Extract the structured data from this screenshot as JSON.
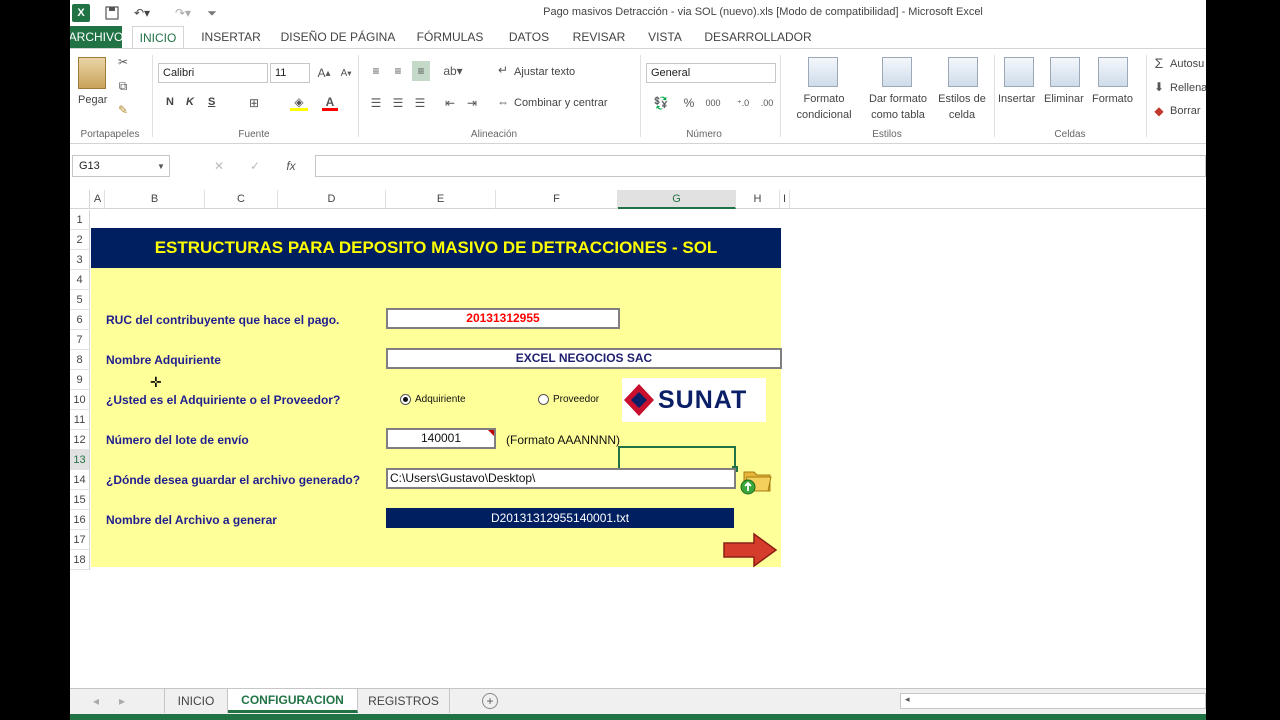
{
  "window": {
    "title": "Pago masivos Detracción - via SOL (nuevo).xls  [Modo de compatibilidad] - Microsoft Excel"
  },
  "tabs": [
    "ARCHIVO",
    "INICIO",
    "INSERTAR",
    "DISEÑO DE PÁGINA",
    "FÓRMULAS",
    "DATOS",
    "REVISAR",
    "VISTA",
    "DESARROLLADOR"
  ],
  "ribbon": {
    "clipboard": {
      "paste": "Pegar",
      "label": "Portapapeles"
    },
    "font": {
      "name": "Calibri",
      "size": "11",
      "bold": "N",
      "italic": "K",
      "underline": "S",
      "label": "Fuente"
    },
    "alignment": {
      "wrap": "Ajustar texto",
      "merge": "Combinar y centrar",
      "label": "Alineación"
    },
    "number": {
      "format": "General",
      "label": "Número"
    },
    "styles": {
      "cond_line1": "Formato",
      "cond_line2": "condicional",
      "table_line1": "Dar formato",
      "table_line2": "como tabla",
      "cell_line1": "Estilos de",
      "cell_line2": "celda",
      "label": "Estilos"
    },
    "cells": {
      "insert": "Insertar",
      "delete": "Eliminar",
      "format": "Formato",
      "label": "Celdas"
    },
    "editing": {
      "autosum": "Autosu",
      "fill": "Rellena",
      "clear": "Borrar"
    }
  },
  "formula_bar": {
    "name_box": "G13",
    "fx": "fx",
    "value": ""
  },
  "columns": [
    "A",
    "B",
    "C",
    "D",
    "E",
    "F",
    "G",
    "H",
    "I"
  ],
  "rows": [
    "1",
    "2",
    "3",
    "4",
    "5",
    "6",
    "7",
    "8",
    "9",
    "10",
    "11",
    "12",
    "13",
    "14",
    "15",
    "16",
    "17",
    "18"
  ],
  "sheet": {
    "banner": "ESTRUCTURAS PARA DEPOSITO MASIVO DE DETRACCIONES - SOL",
    "ruc_label": "RUC del contribuyente que hace el pago.",
    "ruc_value": "20131312955",
    "name_label": "Nombre Adquiriente",
    "name_value": "EXCEL NEGOCIOS SAC",
    "role_label": "¿Usted es el Adquiriente o el Proveedor?",
    "role_option1": "Adquiriente",
    "role_option2": "Proveedor",
    "sunat_logo": "SUNAT",
    "lot_label": "Número del lote de envío",
    "lot_value": "140001",
    "lot_hint": "(Formato AAANNNN)",
    "path_label": "¿Dónde desea guardar el archivo generado?",
    "path_value": "C:\\Users\\Gustavo\\Desktop\\",
    "file_label": "Nombre del Archivo a generar",
    "file_value": "D20131312955140001.txt"
  },
  "sheet_tabs": [
    "INICIO",
    "CONFIGURACION",
    "REGISTROS"
  ],
  "colors": {
    "excel_green": "#217346",
    "banner_bg": "#001f60",
    "banner_text": "#ffff00",
    "panel_bg": "#ffff99",
    "label_text": "#1f1f8f",
    "ruc_text": "#ff0000"
  }
}
